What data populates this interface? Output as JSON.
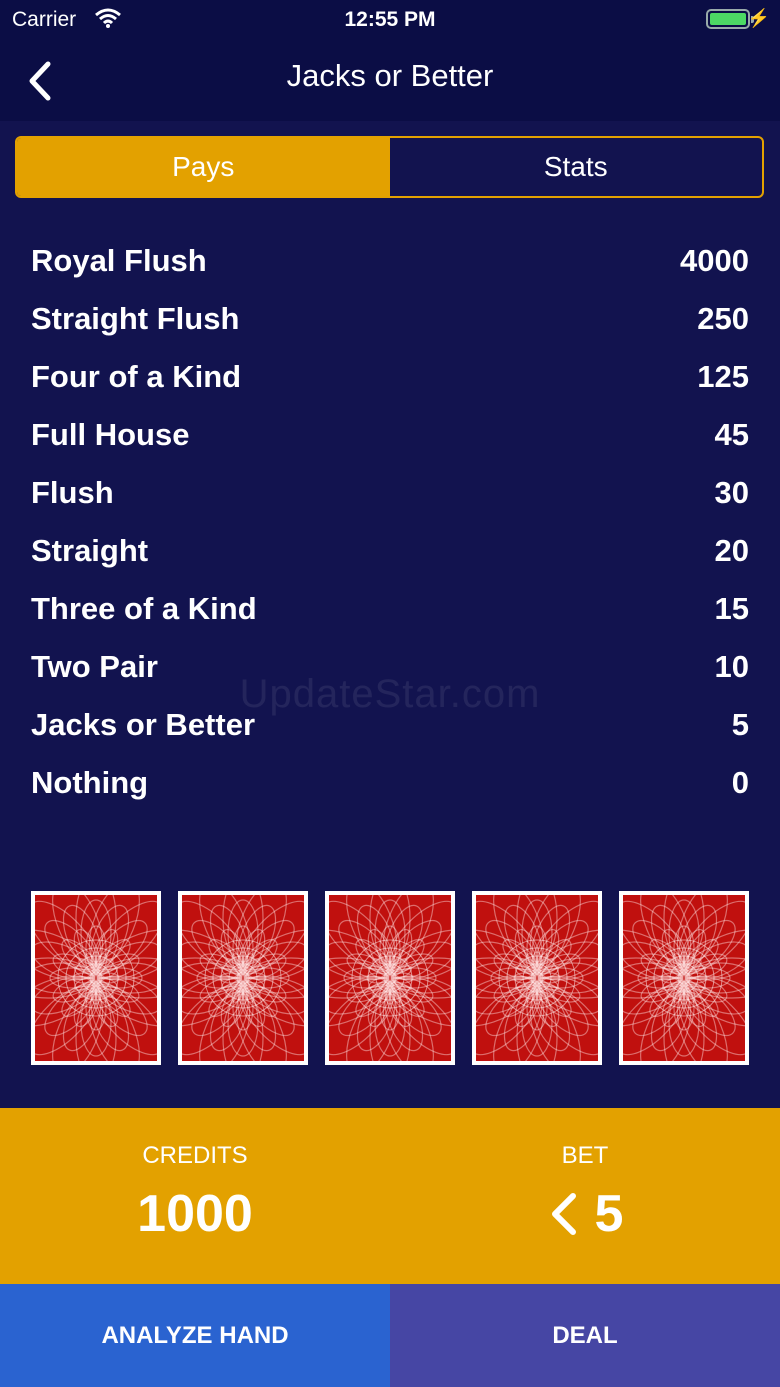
{
  "status_bar": {
    "carrier": "Carrier",
    "time": "12:55 PM"
  },
  "nav": {
    "title": "Jacks or Better"
  },
  "tabs": [
    {
      "label": "Pays",
      "active": true
    },
    {
      "label": "Stats",
      "active": false
    }
  ],
  "pay_table": [
    {
      "hand": "Royal Flush",
      "payout": "4000"
    },
    {
      "hand": "Straight Flush",
      "payout": "250"
    },
    {
      "hand": "Four of a Kind",
      "payout": "125"
    },
    {
      "hand": "Full House",
      "payout": "45"
    },
    {
      "hand": "Flush",
      "payout": "30"
    },
    {
      "hand": "Straight",
      "payout": "20"
    },
    {
      "hand": "Three of a Kind",
      "payout": "15"
    },
    {
      "hand": "Two Pair",
      "payout": "10"
    },
    {
      "hand": "Jacks or Better",
      "payout": "5"
    },
    {
      "hand": "Nothing",
      "payout": "0"
    }
  ],
  "watermark": "UpdateStar.com",
  "cards": [
    {
      "state": "face-down"
    },
    {
      "state": "face-down"
    },
    {
      "state": "face-down"
    },
    {
      "state": "face-down"
    },
    {
      "state": "face-down"
    }
  ],
  "credits": {
    "label": "CREDITS",
    "value": "1000"
  },
  "bet": {
    "label": "BET",
    "value": "5"
  },
  "buttons": {
    "analyze": "ANALYZE HAND",
    "deal": "DEAL"
  },
  "colors": {
    "background": "#12134f",
    "accent": "#e3a100",
    "analyze": "#2a63d0",
    "deal": "#4646a4",
    "card_back": "#c0100e"
  }
}
